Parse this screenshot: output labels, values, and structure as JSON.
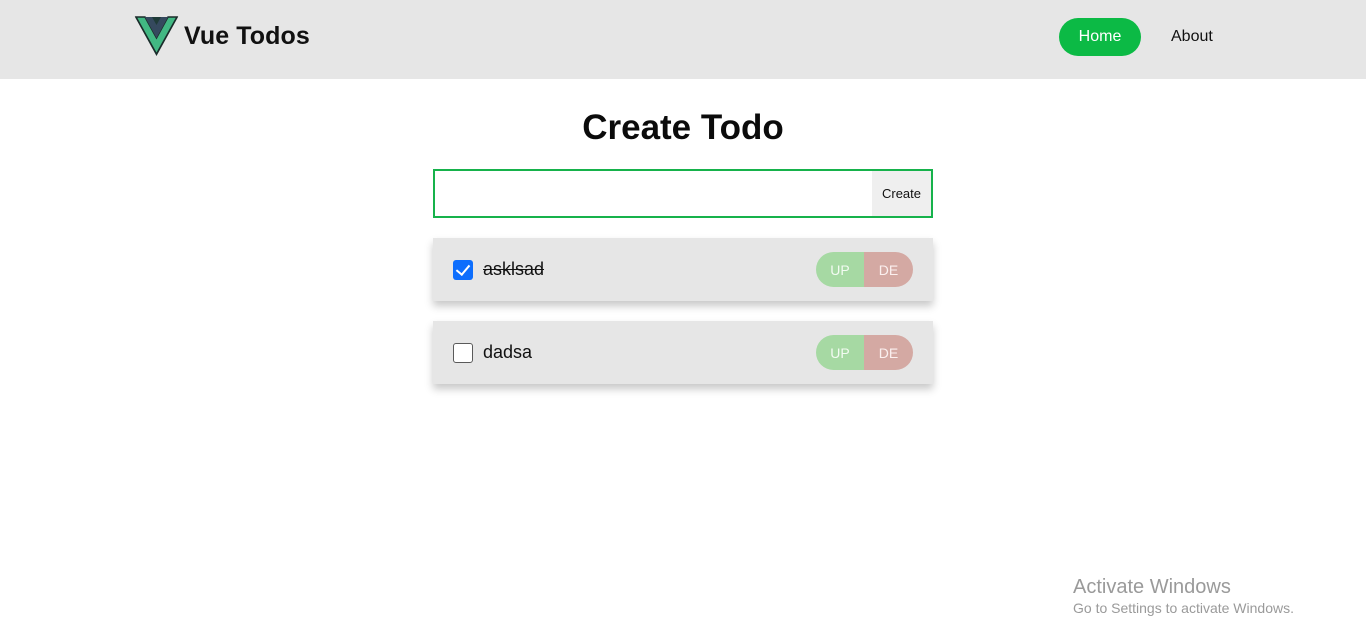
{
  "header": {
    "title": "Vue Todos",
    "logo_icon": "vue-logo-icon",
    "nav": {
      "home_label": "Home",
      "about_label": "About",
      "active": "Home"
    }
  },
  "main": {
    "title": "Create Todo",
    "create": {
      "input_value": "",
      "button_label": "Create"
    },
    "todos": [
      {
        "text": "asklsad",
        "checked": true,
        "up_label": "UP",
        "de_label": "DE"
      },
      {
        "text": "dadsa",
        "checked": false,
        "up_label": "UP",
        "de_label": "DE"
      }
    ]
  },
  "watermark": {
    "title": "Activate Windows",
    "subtitle": "Go to Settings to activate Windows."
  },
  "colors": {
    "header_bg": "#e6e6e6",
    "accent_green": "#0cba45",
    "input_border": "#16b24b",
    "checkbox_blue": "#0d6efd",
    "up_button": "#a6d9a3",
    "de_button": "#d4a9a3"
  }
}
